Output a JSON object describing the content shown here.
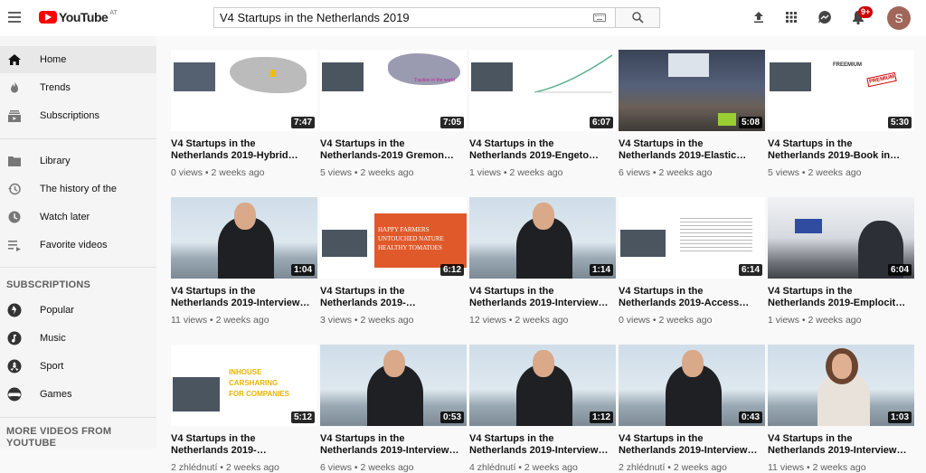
{
  "header": {
    "logo_text": "YouTube",
    "logo_country": "AT",
    "search_value": "V4 Startups in the Netherlands 2019",
    "notification_count": "9+",
    "avatar_letter": "S"
  },
  "sidebar": {
    "main": [
      {
        "label": "Home",
        "icon": "home-icon"
      },
      {
        "label": "Trends",
        "icon": "fire-icon"
      },
      {
        "label": "Subscriptions",
        "icon": "subscriptions-icon"
      }
    ],
    "library": [
      {
        "label": "Library",
        "icon": "folder-icon"
      },
      {
        "label": "The history of the",
        "icon": "history-icon"
      },
      {
        "label": "Watch later",
        "icon": "clock-icon"
      },
      {
        "label": "Favorite videos",
        "icon": "playlist-icon"
      }
    ],
    "subscriptions_heading": "SUBSCRIPTIONS",
    "subscriptions": [
      {
        "label": "Popular",
        "icon": "popular-icon"
      },
      {
        "label": "Music",
        "icon": "music-icon"
      },
      {
        "label": "Sport",
        "icon": "sport-icon"
      },
      {
        "label": "Games",
        "icon": "games-icon"
      }
    ],
    "more_heading_1": "MORE VIDEOS FROM",
    "more_heading_2": "YOUTUBE"
  },
  "videos": [
    {
      "t1": "V4 Startups in the",
      "t2": "Netherlands 2019-Hybrid…",
      "views": "0 views",
      "age": "2 weeks ago",
      "duration": "7:47",
      "thumb": "map-slide"
    },
    {
      "t1": "V4 Startups in the",
      "t2": "Netherlands-2019 Gremon…",
      "views": "5 views",
      "age": "2 weeks ago",
      "duration": "7:05",
      "thumb": "world-slide"
    },
    {
      "t1": "V4 Startups in the",
      "t2": "Netherlands 2019-Engeto…",
      "views": "1 views",
      "age": "2 weeks ago",
      "duration": "6:07",
      "thumb": "graph-slide"
    },
    {
      "t1": "V4 Startups in the",
      "t2": "Netherlands 2019-Elastic…",
      "views": "6 views",
      "age": "2 weeks ago",
      "duration": "5:08",
      "thumb": "audience"
    },
    {
      "t1": "V4 Startups in the",
      "t2": "Netherlands 2019-Book in…",
      "views": "5 views",
      "age": "2 weeks ago",
      "duration": "5:30",
      "thumb": "premium-slide"
    },
    {
      "t1": "V4 Startups in the",
      "t2": "Netherlands 2019-Interview…",
      "views": "11 views",
      "age": "2 weeks ago",
      "duration": "1:04",
      "thumb": "interview"
    },
    {
      "t1": "V4 Startups in the",
      "t2": "Netherlands 2019-…",
      "views": "3 views",
      "age": "2 weeks ago",
      "duration": "6:12",
      "thumb": "farmers-slide"
    },
    {
      "t1": "V4 Startups in the",
      "t2": "Netherlands 2019-Interview…",
      "views": "12 views",
      "age": "2 weeks ago",
      "duration": "1:14",
      "thumb": "interview"
    },
    {
      "t1": "V4 Startups in the",
      "t2": "Netherlands 2019-Access…",
      "views": "0 views",
      "age": "2 weeks ago",
      "duration": "6:14",
      "thumb": "text-slide"
    },
    {
      "t1": "V4 Startups in the",
      "t2": "Netherlands 2019-Emplocit…",
      "views": "1 views",
      "age": "2 weeks ago",
      "duration": "6:04",
      "thumb": "audience2"
    },
    {
      "t1": "V4 Startups in the",
      "t2": "Netherlands 2019-…",
      "views": "2 zhlédnutí",
      "age": "2 weeks ago",
      "duration": "5:12",
      "thumb": "carsharing-slide"
    },
    {
      "t1": "V4 Startups in the",
      "t2": "Netherlands 2019-Interview…",
      "views": "6 views",
      "age": "2 weeks ago",
      "duration": "0:53",
      "thumb": "interview"
    },
    {
      "t1": "V4 Startups in the",
      "t2": "Netherlands 2019-Interview…",
      "views": "4 zhlédnutí",
      "age": "2 weeks ago",
      "duration": "1:12",
      "thumb": "interview"
    },
    {
      "t1": "V4 Startups in the",
      "t2": "Netherlands 2019-Interview…",
      "views": "2 zhlédnutí",
      "age": "2 weeks ago",
      "duration": "0:43",
      "thumb": "interview"
    },
    {
      "t1": "V4 Startups in the",
      "t2": "Netherlands 2019-Interview…",
      "views": "11 views",
      "age": "2 weeks ago",
      "duration": "1:03",
      "thumb": "interview-woman"
    }
  ],
  "thumb_text": {
    "farmers_1": "HAPPY FARMERS",
    "farmers_2": "UNTOUCHED NATURE",
    "farmers_3": "HEALTHY TOMATOES",
    "carsharing_1": "INHOUSE",
    "carsharing_2": "CARSHARING",
    "carsharing_3": "FOR COMPANIES",
    "premium": "PREMIUM",
    "freemium": "FREEMIUM",
    "traction": "Traction in the world"
  },
  "colors": {
    "accent": "#ff0000",
    "badge": "#cc0000",
    "orange_slide": "#e0592a",
    "carsharing_yellow": "#e8b400"
  }
}
